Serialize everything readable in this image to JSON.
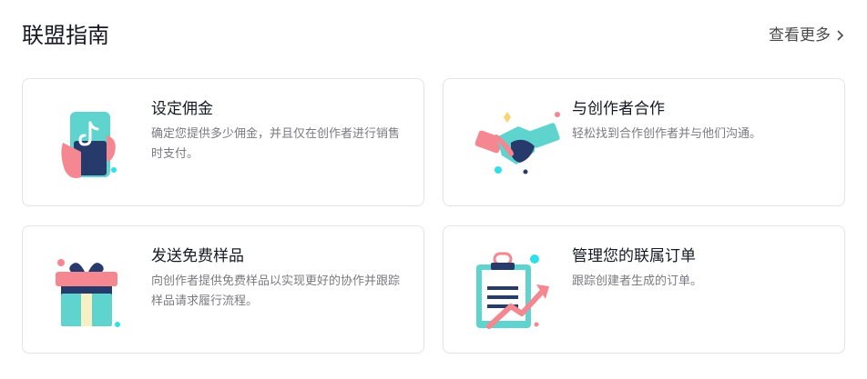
{
  "header": {
    "title": "联盟指南",
    "more_label": "查看更多"
  },
  "cards": [
    {
      "title": "设定佣金",
      "description": "确定您提供多少佣金，并且仅在创作者进行销售时支付。"
    },
    {
      "title": "与创作者合作",
      "description": "轻松找到合作创作者并与他们沟通。"
    },
    {
      "title": "发送免费样品",
      "description": "向创作者提供免费样品以实现更好的协作并跟踪样品请求履行流程。"
    },
    {
      "title": "管理您的联属订单",
      "description": "跟踪创建者生成的订单。"
    }
  ],
  "colors": {
    "teal": "#5fd4cf",
    "pink": "#f4878f",
    "navy": "#263a6b",
    "yellow": "#f7d46d",
    "cyan_dot": "#2fe0e8"
  },
  "icons": [
    "phone-hand-icon",
    "handshake-icon",
    "gift-box-icon",
    "clipboard-chart-icon",
    "chevron-right-icon"
  ]
}
